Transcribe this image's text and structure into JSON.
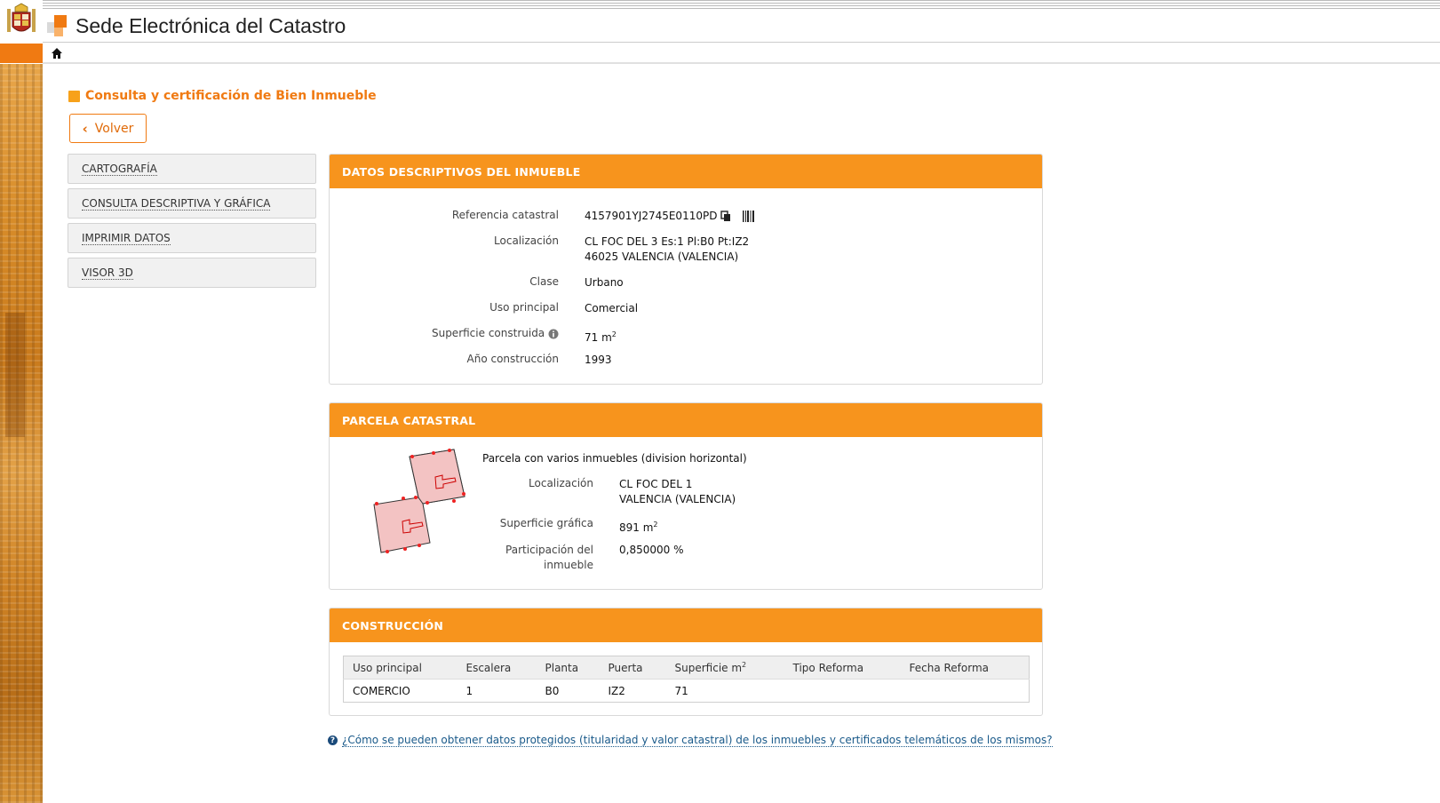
{
  "site": {
    "title": "Sede Electrónica del Catastro"
  },
  "page": {
    "title": "Consulta y certificación de Bien Inmueble",
    "back_label": "Volver"
  },
  "side_menu": [
    {
      "label": "CARTOGRAFÍA"
    },
    {
      "label": "CONSULTA DESCRIPTIVA Y GRÁFICA"
    },
    {
      "label": "IMPRIMIR DATOS"
    },
    {
      "label": "VISOR 3D"
    }
  ],
  "datos": {
    "heading": "DATOS DESCRIPTIVOS DEL INMUEBLE",
    "referencia_label": "Referencia catastral",
    "referencia_value": "4157901YJ2745E0110PD",
    "localizacion_label": "Localización",
    "localizacion_line1": "CL FOC DEL 3 Es:1 Pl:B0 Pt:IZ2",
    "localizacion_line2": "46025 VALENCIA (VALENCIA)",
    "clase_label": "Clase",
    "clase_value": "Urbano",
    "uso_label": "Uso principal",
    "uso_value": "Comercial",
    "superficie_label": "Superficie construida",
    "superficie_value": "71 m",
    "superficie_unit_sup": "2",
    "ano_label": "Año construcción",
    "ano_value": "1993"
  },
  "parcela": {
    "heading": "PARCELA CATASTRAL",
    "description": "Parcela con varios inmuebles (division horizontal)",
    "localizacion_label": "Localización",
    "localizacion_line1": "CL FOC DEL 1",
    "localizacion_line2": "VALENCIA (VALENCIA)",
    "superficie_label": "Superficie gráfica",
    "superficie_value": "891 m",
    "superficie_unit_sup": "2",
    "participacion_label_line1": "Participación del",
    "participacion_label_line2": "inmueble",
    "participacion_value": "0,850000 %"
  },
  "construccion": {
    "heading": "CONSTRUCCIÓN",
    "columns": [
      "Uso principal",
      "Escalera",
      "Planta",
      "Puerta",
      "Superficie m",
      "Tipo Reforma",
      "Fecha Reforma"
    ],
    "superficie_col_sup": "2",
    "rows": [
      [
        "COMERCIO",
        "1",
        "B0",
        "IZ2",
        "71",
        "",
        ""
      ]
    ]
  },
  "help_link": "¿Cómo se pueden obtener datos protegidos (titularidad y valor catastral) de los inmuebles y certificados telemáticos de los mismos?",
  "colors": {
    "accent": "#f7941d",
    "accent_dark": "#f07a12",
    "link": "#1a5a8a"
  }
}
